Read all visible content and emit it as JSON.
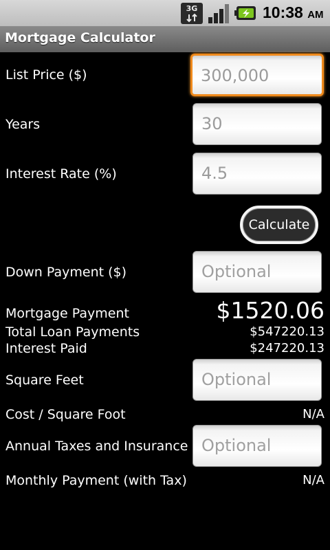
{
  "status_bar": {
    "network_type": "3G",
    "time": "10:38",
    "ampm": "AM"
  },
  "app": {
    "title": "Mortgage Calculator"
  },
  "form": {
    "list_price_label": "List Price ($)",
    "list_price_value": "300,000",
    "years_label": "Years",
    "years_value": "30",
    "interest_rate_label": "Interest Rate (%)",
    "interest_rate_value": "4.5",
    "calculate_label": "Calculate",
    "down_payment_label": "Down Payment ($)",
    "down_payment_placeholder": "Optional"
  },
  "results": {
    "mortgage_payment_label": "Mortgage Payment",
    "mortgage_payment_value": "$1520.06",
    "total_loan_payments_label": "Total Loan Payments",
    "total_loan_payments_value": "$547220.13",
    "interest_paid_label": "Interest Paid",
    "interest_paid_value": "$247220.13"
  },
  "extras": {
    "square_feet_label": "Square Feet",
    "square_feet_placeholder": "Optional",
    "cost_per_sqft_label": "Cost / Square Foot",
    "cost_per_sqft_value": "N/A",
    "annual_taxes_label": "Annual Taxes and Insurance",
    "annual_taxes_placeholder": "Optional",
    "monthly_with_tax_label": "Monthly Payment (with Tax)",
    "monthly_with_tax_value": "N/A"
  },
  "colors": {
    "focus_accent": "#f08a1c",
    "background": "#000000",
    "battery_green": "#7cc51e"
  },
  "icons": {
    "network": "network-3g-icon",
    "signal": "signal-strength-icon",
    "battery": "battery-charging-icon"
  }
}
